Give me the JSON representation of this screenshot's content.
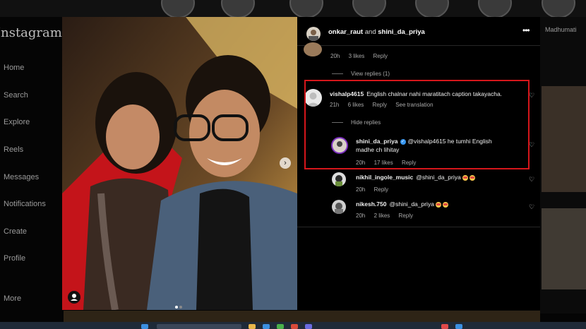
{
  "sidebar": {
    "logo": "Instagram",
    "items": [
      {
        "label": "Home"
      },
      {
        "label": "Search"
      },
      {
        "label": "Explore"
      },
      {
        "label": "Reels"
      },
      {
        "label": "Messages"
      },
      {
        "label": "Notifications"
      },
      {
        "label": "Create"
      },
      {
        "label": "Profile"
      },
      {
        "label": "More"
      }
    ]
  },
  "right_feed": {
    "name": "Madhumati"
  },
  "post": {
    "header": {
      "user1": "onkar_raut",
      "conjunction": "and",
      "user2": "shini_da_priya",
      "more_icon": "more-horizontal-icon"
    },
    "carousel_index": 1,
    "carousel_total": 2,
    "next_icon": "chevron-right-icon",
    "tag_icon": "user-tag-icon"
  },
  "comments": {
    "prev_reply": {
      "time": "20h",
      "likes": "3 likes",
      "reply": "Reply"
    },
    "view_replies": "View replies (1)",
    "main": {
      "username": "vishalp4615",
      "text": "English chalnar nahi maratitach caption takayacha.",
      "time": "21h",
      "likes": "6 likes",
      "reply": "Reply",
      "translation": "See translation"
    },
    "hide_replies": "Hide replies",
    "replies": [
      {
        "username": "shini_da_priya",
        "verified": true,
        "text_line1": "@vishalp4615 he tumhi English",
        "text_line2": "madhe ch lihitay",
        "time": "20h",
        "likes": "17 likes",
        "reply": "Reply"
      },
      {
        "username": "nikhil_ingole_music",
        "text": "@shini_da_priya",
        "time": "20h",
        "likes": "",
        "reply": "Reply"
      },
      {
        "username": "nikesh.750",
        "text": "@shini_da_priya",
        "time": "20h",
        "likes": "2 likes",
        "reply": "Reply"
      }
    ]
  },
  "colors": {
    "highlight_box": "#d5161b",
    "verified": "#3897f0",
    "red_carpet": "#c4141a"
  }
}
